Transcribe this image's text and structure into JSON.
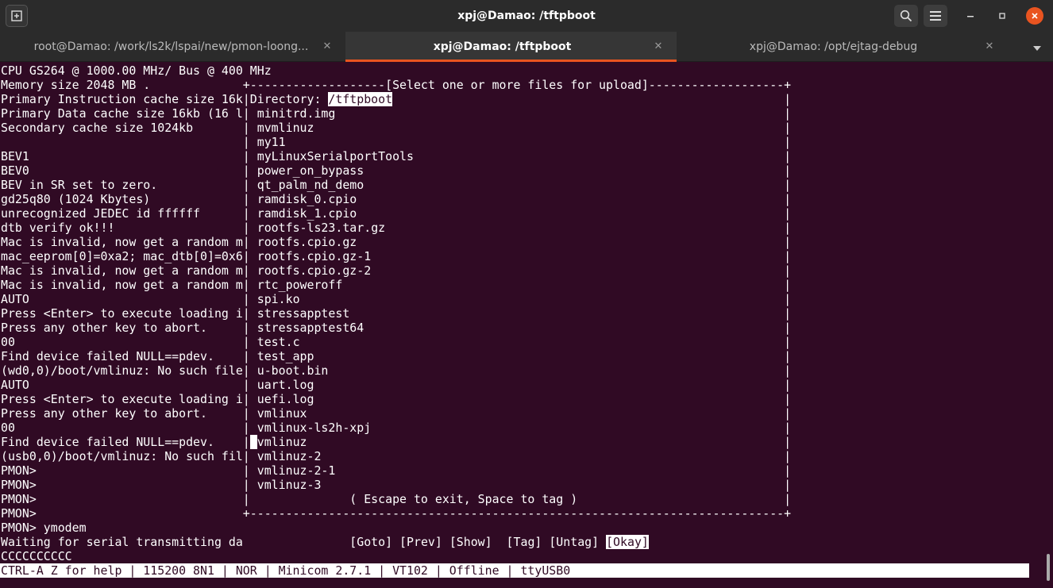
{
  "window": {
    "title": "xpj@Damao: /tftpboot"
  },
  "tabs": [
    {
      "label": "root@Damao: /work/ls2k/lspai/new/pmon-loong...",
      "close": "✕"
    },
    {
      "label": "xpj@Damao: /tftpboot",
      "close": "✕"
    },
    {
      "label": "xpj@Damao: /opt/ejtag-debug",
      "close": "✕"
    }
  ],
  "terminal": {
    "left_lines": [
      "CPU GS264 @ 1000.00 MHz/ Bus @ 400 MHz",
      "Memory size 2048 MB .",
      "Primary Instruction cache size 16k",
      "Primary Data cache size 16kb (16 l",
      "Secondary cache size 1024kb",
      "",
      "BEV1",
      "BEV0",
      "BEV in SR set to zero.",
      "gd25q80 (1024 Kbytes)",
      "unrecognized JEDEC id ffffff",
      "dtb verify ok!!!",
      "Mac is invalid, now get a random m",
      "mac_eeprom[0]=0xa2; mac_dtb[0]=0x6",
      "Mac is invalid, now get a random m",
      "Mac is invalid, now get a random m",
      "AUTO",
      "Press <Enter> to execute loading i",
      "Press any other key to abort.",
      "00",
      "Find device failed NULL==pdev.",
      "(wd0,0)/boot/vmlinuz: No such file",
      "AUTO",
      "Press <Enter> to execute loading i",
      "Press any other key to abort.",
      "00",
      "Find device failed NULL==pdev.",
      "(usb0,0)/boot/vmlinuz: No such fil",
      "PMON>",
      "PMON>",
      "PMON>",
      "PMON>",
      "PMON> ymodem",
      "Waiting for serial transmitting da",
      "CCCCCCCCCC"
    ],
    "dialog": {
      "title": "[Select one or more files for upload]",
      "directory_label": "Directory: ",
      "directory_path": "/tftpboot",
      "files": [
        "minitrd.img",
        "mvmlinuz",
        "my11",
        "myLinuxSerialportTools",
        "power_on_bypass",
        "qt_palm_nd_demo",
        "ramdisk_0.cpio",
        "ramdisk_1.cpio",
        "rootfs-ls23.tar.gz",
        "rootfs.cpio.gz",
        "rootfs.cpio.gz-1",
        "rootfs.cpio.gz-2",
        "rtc_poweroff",
        "spi.ko",
        "stressapptest",
        "stressapptest64",
        "test.c",
        "test_app",
        "u-boot.bin",
        "uart.log",
        "uefi.log",
        "vmlinux",
        "vmlinux-ls2h-xpj",
        "vmlinuz",
        "vmlinuz-2",
        "vmlinuz-2-1",
        "vmlinuz-3"
      ],
      "hint": "( Escape to exit, Space to tag )",
      "buttons": [
        "[Goto]",
        "[Prev]",
        "[Show]",
        "[Tag]",
        "[Untag]",
        "[Okay]"
      ],
      "selected_button": "[Okay]"
    },
    "status_line": "CTRL-A Z for help | 115200 8N1 | NOR | Minicom 2.7.1 | VT102 | Offline | ttyUSB0"
  }
}
